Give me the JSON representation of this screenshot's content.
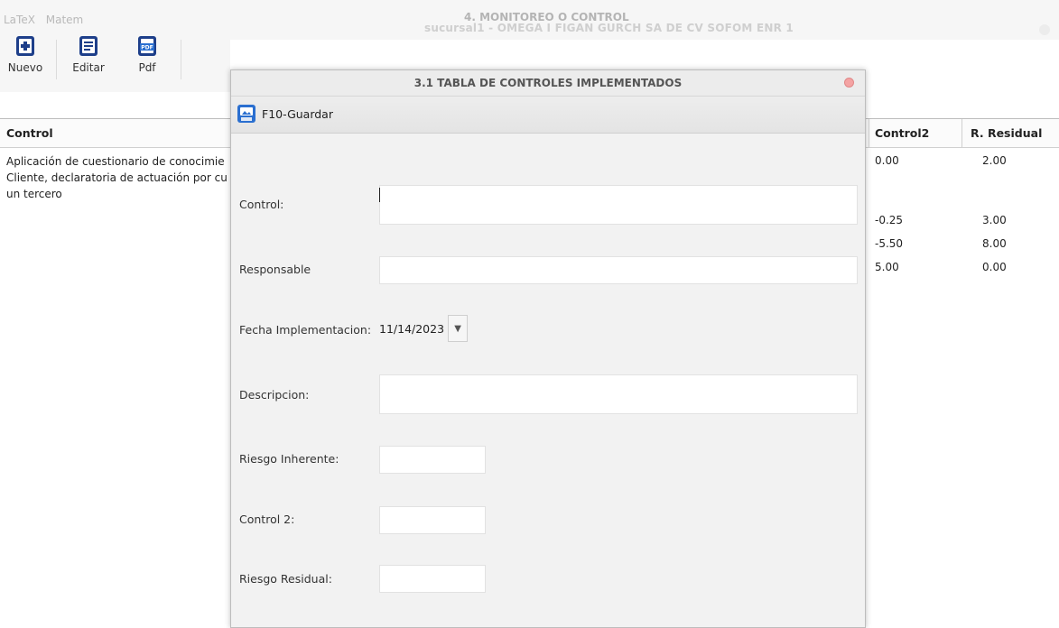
{
  "background_window": {
    "menu": [
      "LaTeX",
      "Matem"
    ],
    "title": "4. MONITOREO O CONTROL",
    "subtitle_ghost": "sucursal1 - OMEGA I FIGAN GURCH SA DE CV SOFOM ENR 1",
    "toolbar": {
      "new_label": "Nuevo",
      "edit_label": "Editar",
      "pdf_label": "Pdf"
    },
    "table": {
      "headers": {
        "control": "Control",
        "control2": "Control2",
        "residual": "R. Residual"
      },
      "row1_control_lines": [
        "Aplicación de cuestionario de conocimie",
        "Cliente, declaratoria de actuación por cu",
        "un tercero"
      ],
      "rows": [
        {
          "control2": "0.00",
          "residual": "2.00"
        },
        {
          "control2": "-0.25",
          "residual": "3.00"
        },
        {
          "control2": "-5.50",
          "residual": "8.00"
        },
        {
          "control2": "5.00",
          "residual": "0.00"
        }
      ]
    }
  },
  "dialog": {
    "title": "3.1 TABLA DE CONTROLES IMPLEMENTADOS",
    "save_label": "F10-Guardar",
    "fields": {
      "control_label": "Control:",
      "control_value": "",
      "responsable_label": "Responsable",
      "responsable_value": "",
      "fecha_label": "Fecha Implementacion:",
      "fecha_value": "11/14/2023",
      "descripcion_label": "Descripcion:",
      "descripcion_value": "",
      "riesgo_inherente_label": "Riesgo Inherente:",
      "riesgo_inherente_value": "",
      "control2_label": "Control 2:",
      "control2_value": "",
      "riesgo_residual_label": "Riesgo Residual:",
      "riesgo_residual_value": ""
    }
  },
  "colors": {
    "accent_blue": "#2a6fd0",
    "close_red": "#f4a3a3"
  }
}
